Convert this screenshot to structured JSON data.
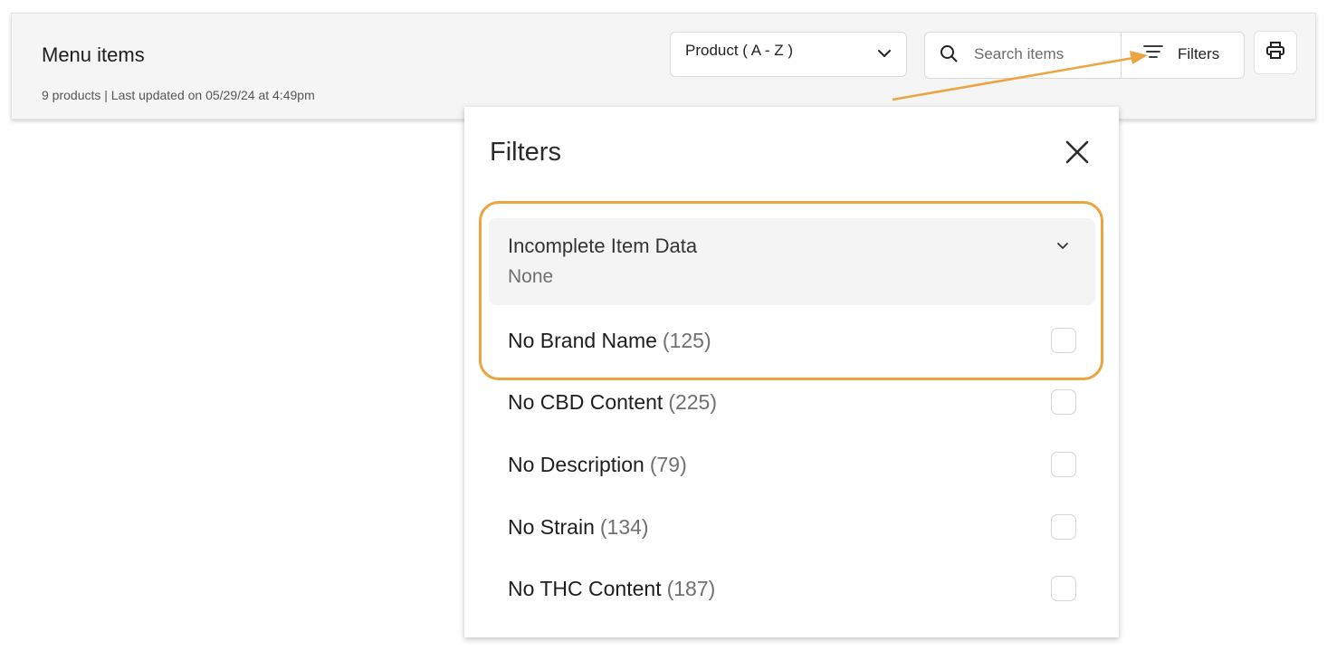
{
  "header": {
    "title": "Menu items",
    "meta": "9 products | Last updated on 05/29/24 at 4:49pm"
  },
  "sort": {
    "selected": "Product ( A - Z )",
    "chevron_icon": "chevron-down-icon"
  },
  "search": {
    "placeholder": "Search items",
    "value": "",
    "icon": "search-icon"
  },
  "filters_button": {
    "label": "Filters",
    "icon": "filter-lines-icon"
  },
  "print_button": {
    "icon": "printer-icon"
  },
  "filters_panel": {
    "title": "Filters",
    "close_icon": "close-icon",
    "accordion": {
      "title": "Incomplete Item Data",
      "value": "None",
      "icon": "chevron-down-icon"
    },
    "options": [
      {
        "label": "No Brand Name",
        "count": "(125)",
        "checked": false
      },
      {
        "label": "No CBD Content",
        "count": "(225)",
        "checked": false
      },
      {
        "label": "No Description",
        "count": "(79)",
        "checked": false
      },
      {
        "label": "No Strain",
        "count": "(134)",
        "checked": false
      },
      {
        "label": "No THC Content",
        "count": "(187)",
        "checked": false
      }
    ]
  },
  "annotation": {
    "accent_color": "#eba440"
  }
}
